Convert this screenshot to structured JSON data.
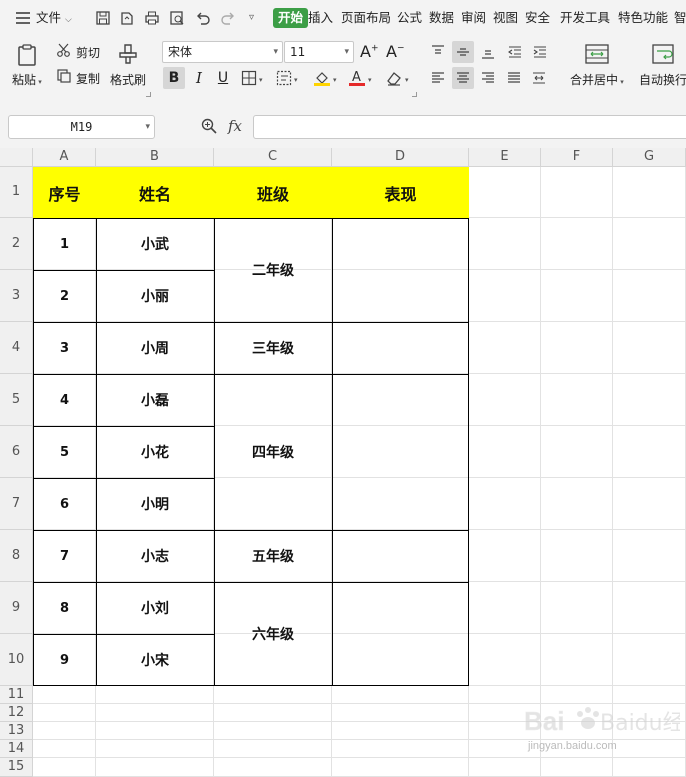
{
  "menubar": {
    "file": "文件",
    "tabs": [
      "开始",
      "插入",
      "页面布局",
      "公式",
      "数据",
      "审阅",
      "视图",
      "安全",
      "开发工具",
      "特色功能",
      "智"
    ]
  },
  "ribbon": {
    "paste": "粘贴",
    "cut": "剪切",
    "copy": "复制",
    "format_painter": "格式刷",
    "font_name": "宋体",
    "font_size": "11",
    "merge_center": "合并居中",
    "auto_wrap": "自动换行",
    "colors": {
      "font_color": "#e52a2a",
      "fill_color": "#ffd400"
    }
  },
  "formula_bar": {
    "name_box": "M19",
    "fx": "fx",
    "formula": ""
  },
  "columns": [
    "A",
    "B",
    "C",
    "D",
    "E",
    "F",
    "G"
  ],
  "rows": [
    "1",
    "2",
    "3",
    "4",
    "5",
    "6",
    "7",
    "8",
    "9",
    "10",
    "11",
    "12",
    "13",
    "14",
    "15"
  ],
  "table": {
    "headers": [
      "序号",
      "姓名",
      "班级",
      "表现"
    ],
    "numbers": [
      "1",
      "2",
      "3",
      "4",
      "5",
      "6",
      "7",
      "8",
      "9"
    ],
    "names": [
      "小武",
      "小丽",
      "小周",
      "小磊",
      "小花",
      "小明",
      "小志",
      "小刘",
      "小宋"
    ],
    "grades": [
      "二年级",
      "三年级",
      "四年级",
      "五年级",
      "六年级"
    ],
    "header_fill": "#ffff00"
  },
  "watermark": {
    "text": "Baidu经验",
    "url": "jingyan.baidu.com"
  }
}
